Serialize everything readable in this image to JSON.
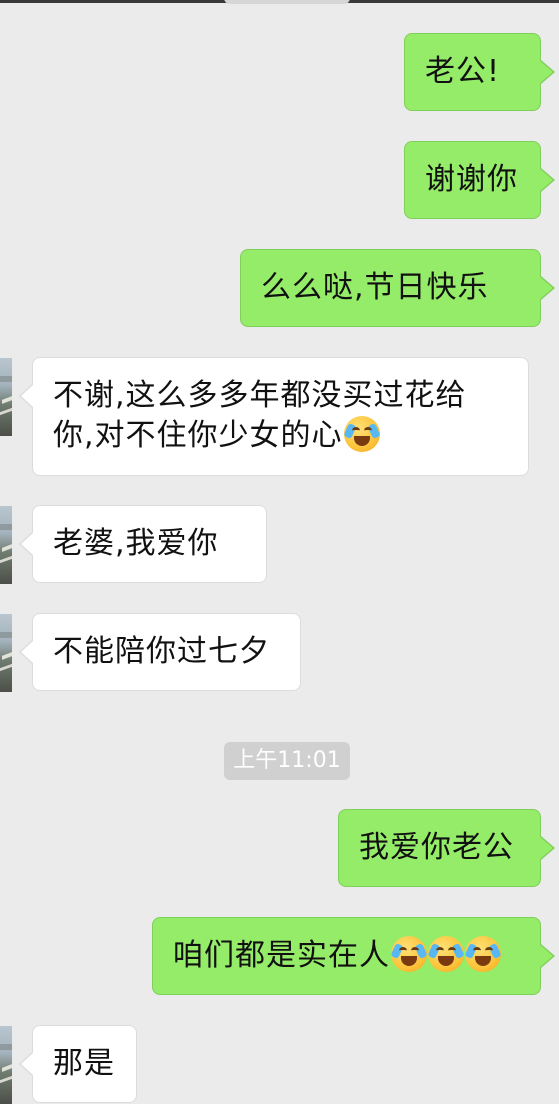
{
  "chat": {
    "messages": [
      {
        "side": "right",
        "text": "老公!"
      },
      {
        "side": "right",
        "text": "谢谢你"
      },
      {
        "side": "right",
        "text": "么么哒,节日快乐"
      },
      {
        "side": "left",
        "text": "不谢,这么多多年都没买过花给你,对不住你少女的心",
        "emoji": "loudly-crying-face"
      },
      {
        "side": "left",
        "text": "老婆,我爱你"
      },
      {
        "side": "left",
        "text": "不能陪你过七夕"
      },
      {
        "side": "right",
        "text": "我爱你老公"
      },
      {
        "side": "right",
        "text": "咱们都是实在人",
        "emoji": "loudly-crying-face x3"
      },
      {
        "side": "left",
        "text": "那是"
      }
    ],
    "timestamp": "上午11:01",
    "colors": {
      "background": "#ebebeb",
      "outgoing_bubble": "#95ec69",
      "incoming_bubble": "#ffffff",
      "timestamp_badge": "#d0d0d0"
    }
  }
}
